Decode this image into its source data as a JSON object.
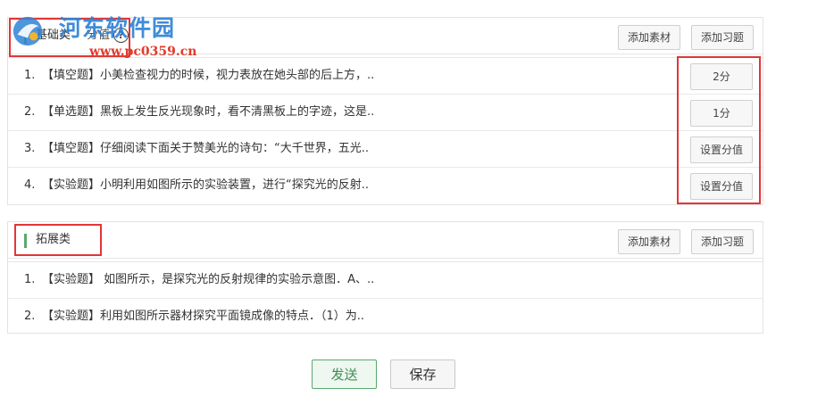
{
  "watermark": {
    "title": "河东软件园",
    "url": "www.pc0359.cn"
  },
  "sections": [
    {
      "title": "基础类",
      "score_label": "分值",
      "help_icon": "?",
      "add_material_label": "添加素材",
      "add_exercise_label": "添加习题",
      "questions": [
        {
          "index": "1.",
          "type": "【填空题】",
          "text": "小美检查视力的时候，视力表放在她头部的后上方，..",
          "score": "2分"
        },
        {
          "index": "2.",
          "type": "【单选题】",
          "text": "黑板上发生反光现象时，看不清黑板上的字迹，这是..",
          "score": "1分"
        },
        {
          "index": "3.",
          "type": "【填空题】",
          "text": "仔细阅读下面关于赞美光的诗句：“大千世界，五光..",
          "score": "设置分值"
        },
        {
          "index": "4.",
          "type": "【实验题】",
          "text": "小明利用如图所示的实验装置，进行“探究光的反射..",
          "score": "设置分值"
        }
      ]
    },
    {
      "title": "拓展类",
      "add_material_label": "添加素材",
      "add_exercise_label": "添加习题",
      "questions": [
        {
          "index": "1.",
          "type": "【实验题】",
          "text": " 如图所示，是探究光的反射规律的实验示意图．A、.."
        },
        {
          "index": "2.",
          "type": "【实验题】",
          "text": "利用如图所示器材探究平面镜成像的特点．（1）为.."
        }
      ]
    }
  ],
  "footer": {
    "send_label": "发送",
    "save_label": "保存"
  },
  "colors": {
    "accent_green": "#5aa96f",
    "highlight_red": "#e23636",
    "watermark_blue": "#2f83d6",
    "watermark_red": "#e23a2a"
  }
}
